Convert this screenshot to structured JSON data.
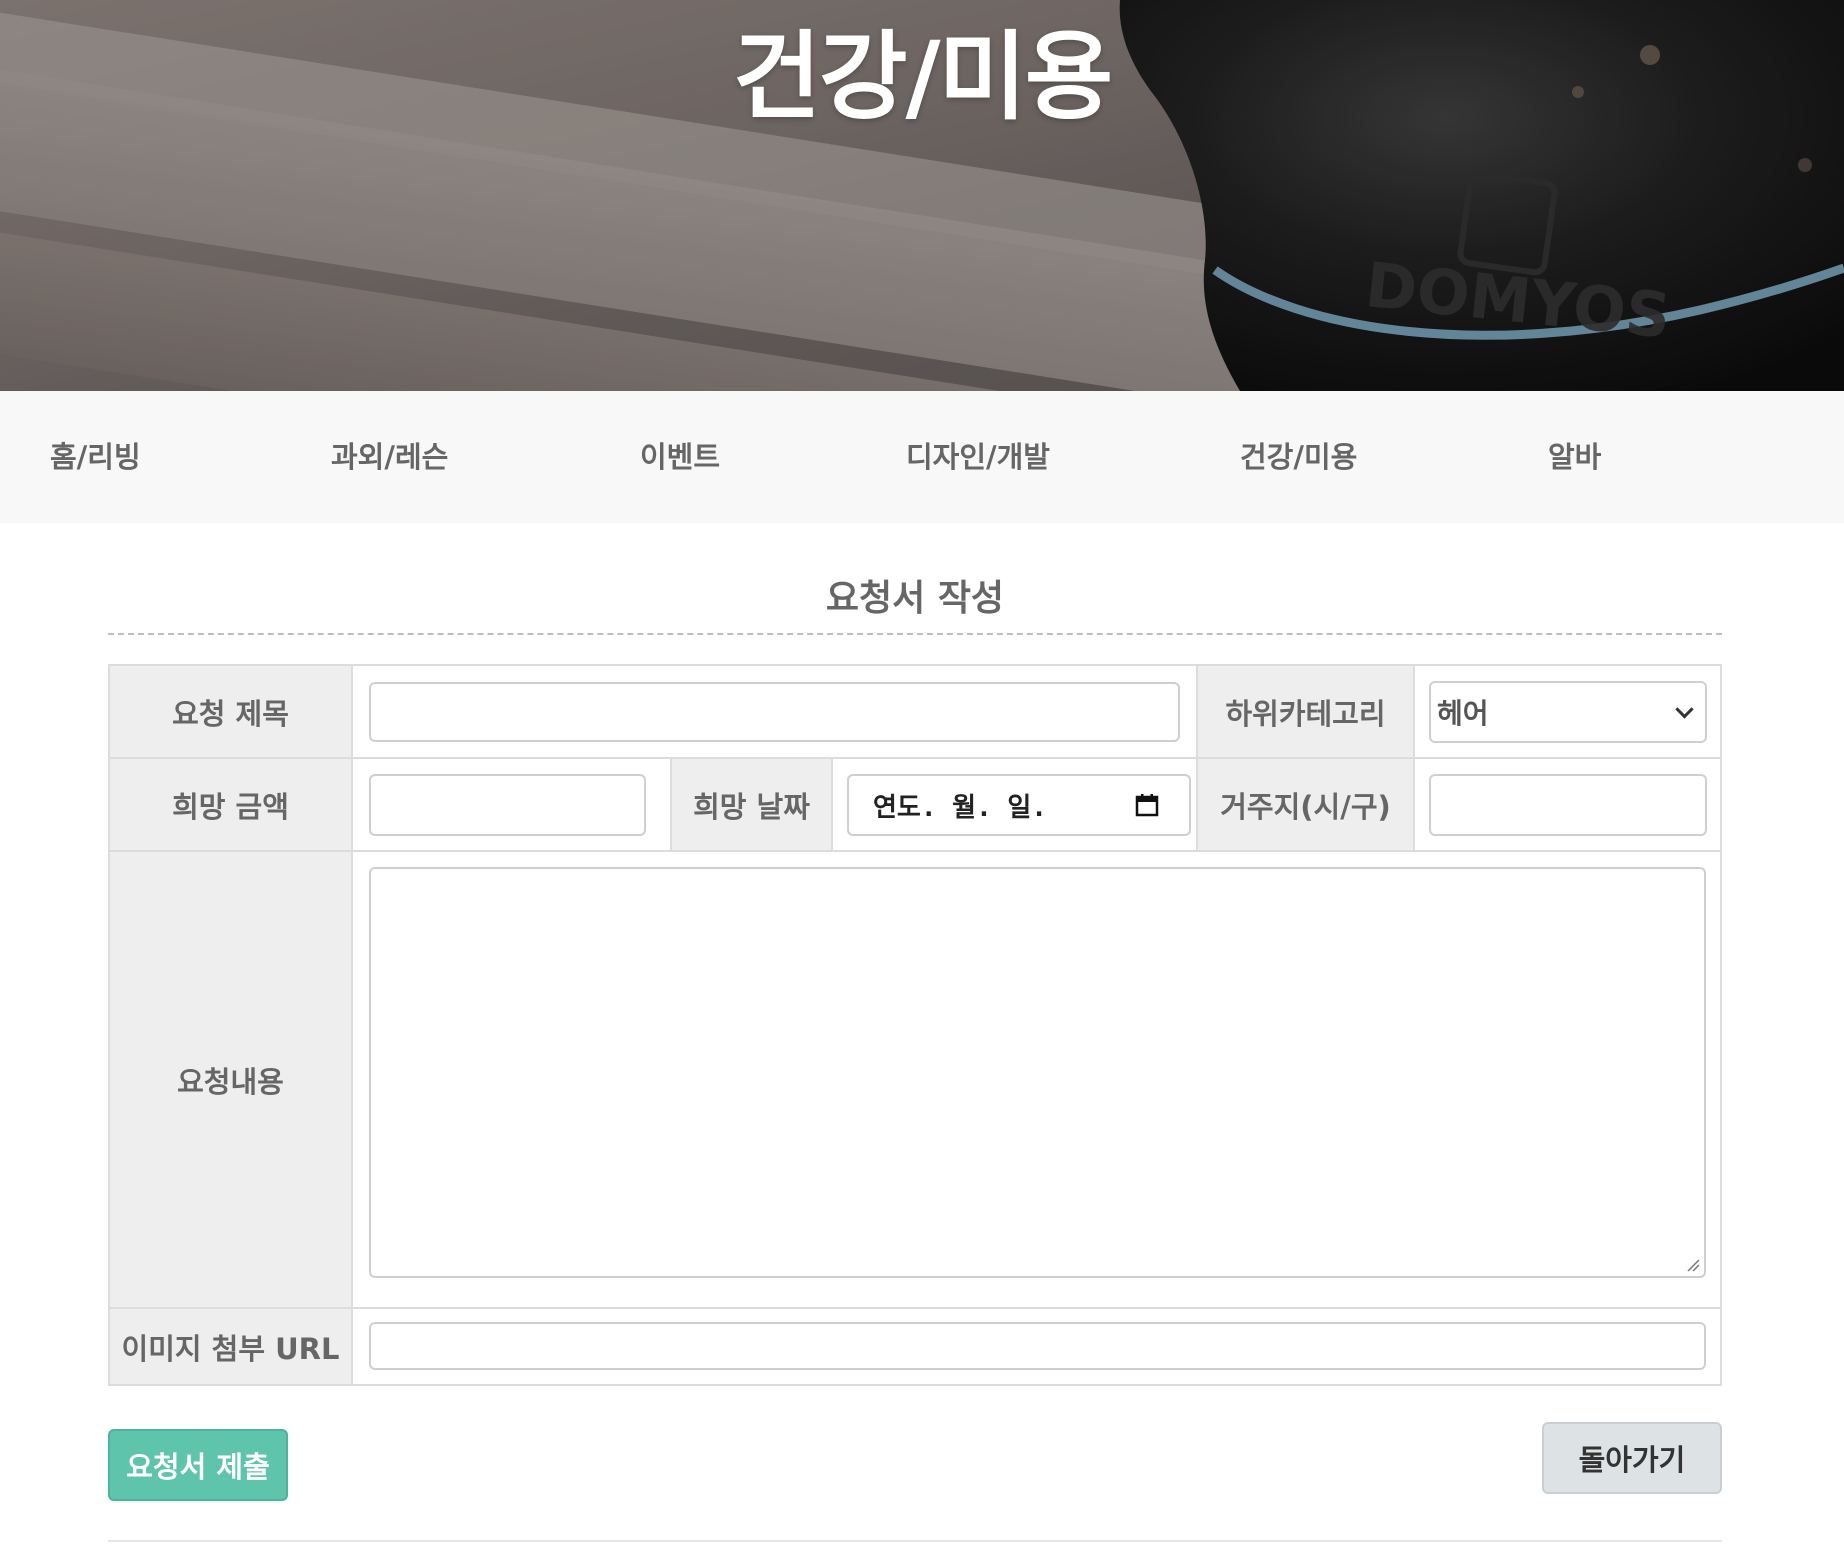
{
  "hero": {
    "title": "건강/미용"
  },
  "nav": {
    "items": [
      {
        "label": "홈/리빙"
      },
      {
        "label": "과외/레슨"
      },
      {
        "label": "이벤트"
      },
      {
        "label": "디자인/개발"
      },
      {
        "label": "건강/미용"
      },
      {
        "label": "알바"
      }
    ]
  },
  "form": {
    "title": "요청서 작성",
    "labels": {
      "request_title": "요청 제목",
      "subcategory": "하위카테고리",
      "desired_amount": "희망 금액",
      "desired_date": "희망 날짜",
      "residence": "거주지(시/구)",
      "content": "요청내용",
      "image_url": "이미지 첨부 URL"
    },
    "values": {
      "request_title": "",
      "subcategory_selected": "헤어",
      "desired_amount": "",
      "desired_date_placeholder": "연도. 월. 일.",
      "residence": "",
      "content": "",
      "image_url": ""
    },
    "buttons": {
      "submit": "요청서 제출",
      "back": "돌아가기"
    }
  },
  "colors": {
    "submit_button": "#5ec4ac",
    "back_button": "#dde2e5",
    "label_background": "#eeeeee",
    "nav_background": "#f8f8f8"
  },
  "icons": {
    "date_picker": "calendar-icon",
    "select": "chevron-down-icon"
  }
}
